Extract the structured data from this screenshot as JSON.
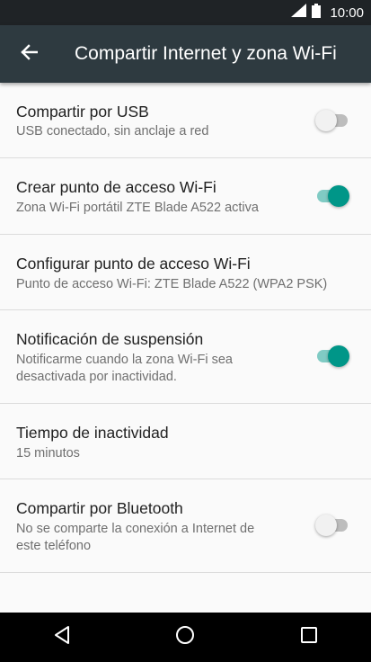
{
  "status_bar": {
    "time": "10:00",
    "icons": [
      "signal-icon",
      "battery-icon"
    ]
  },
  "app_bar": {
    "title": "Compartir Internet y zona Wi-Fi",
    "back_icon": "arrow-back-icon"
  },
  "settings": [
    {
      "title": "Compartir por USB",
      "subtitle": "USB conectado, sin anclaje a red",
      "toggle": "off"
    },
    {
      "title": "Crear punto de acceso Wi-Fi",
      "subtitle": "Zona Wi-Fi portátil ZTE Blade A522 activa",
      "toggle": "on"
    },
    {
      "title": "Configurar punto de acceso Wi-Fi",
      "subtitle": "Punto de acceso Wi-Fi: ZTE Blade A522 (WPA2 PSK)"
    },
    {
      "title": "Notificación de suspensión",
      "subtitle_lines": [
        "Notificarme cuando la zona Wi-Fi sea",
        "desactivada por inactividad."
      ],
      "toggle": "on"
    },
    {
      "title": "Tiempo de inactividad",
      "subtitle": "15 minutos"
    },
    {
      "title": "Compartir por Bluetooth",
      "subtitle_lines": [
        "No se comparte la conexión a Internet de",
        "este teléfono"
      ],
      "toggle": "off"
    }
  ],
  "nav_bar": {
    "icons": [
      "back-triangle-icon",
      "home-circle-icon",
      "recents-square-icon"
    ]
  },
  "colors": {
    "accent": "#009688",
    "app_bar": "#2e3a40",
    "status_bar": "#1f2326"
  }
}
